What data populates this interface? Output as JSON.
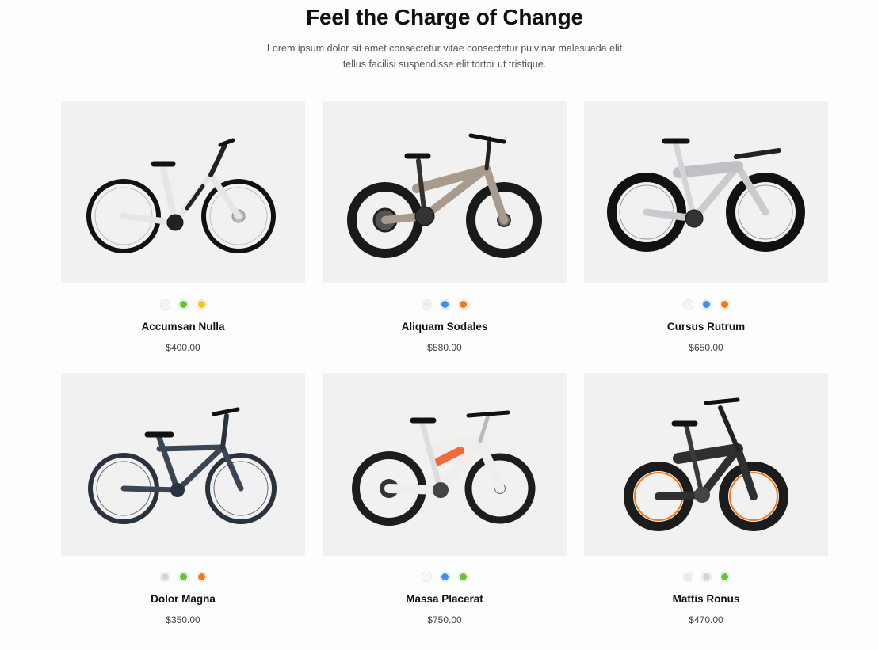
{
  "header": {
    "title": "Feel the Charge of Change",
    "subtitle": "Lorem ipsum dolor sit amet consectetur vitae consectetur pulvinar malesuada elit tellus facilisi suspendisse elit tortor ut tristique."
  },
  "products": [
    {
      "name": "Accumsan Nulla",
      "price": "$400.00",
      "image_icon": "white-city-ebike",
      "frame_color": "#e9e9ec",
      "swatches": [
        "#f3f3f3",
        "#66c23a",
        "#f5c518"
      ]
    },
    {
      "name": "Aliquam Sodales",
      "price": "$580.00",
      "image_icon": "bronze-fat-tire-ebike",
      "frame_color": "#a89a8c",
      "swatches": [
        "#f2e9e4",
        "#3d8ff0",
        "#f07a17"
      ]
    },
    {
      "name": "Cursus Rutrum",
      "price": "$650.00",
      "image_icon": "triathlon-road-bike",
      "frame_color": "#c9cbce",
      "swatches": [
        "#f3f3f3",
        "#3d8ff0",
        "#f07a17"
      ]
    },
    {
      "name": "Dolor Magna",
      "price": "$350.00",
      "image_icon": "dark-commuter-bike",
      "frame_color": "#3b4654",
      "swatches": [
        "#d4d4d4",
        "#66c23a",
        "#f07a17"
      ]
    },
    {
      "name": "Massa Placerat",
      "price": "$750.00",
      "image_icon": "white-mountain-ebike",
      "frame_color": "#f0eeec",
      "swatches": [
        "#f7f7f7",
        "#3d8ff0",
        "#66c23a"
      ]
    },
    {
      "name": "Mattis Ronus",
      "price": "$470.00",
      "image_icon": "black-folding-fat-ebike",
      "frame_color": "#2e2f31",
      "swatches": [
        "#f2e9e4",
        "#d4d4d4",
        "#66c23a"
      ]
    }
  ]
}
